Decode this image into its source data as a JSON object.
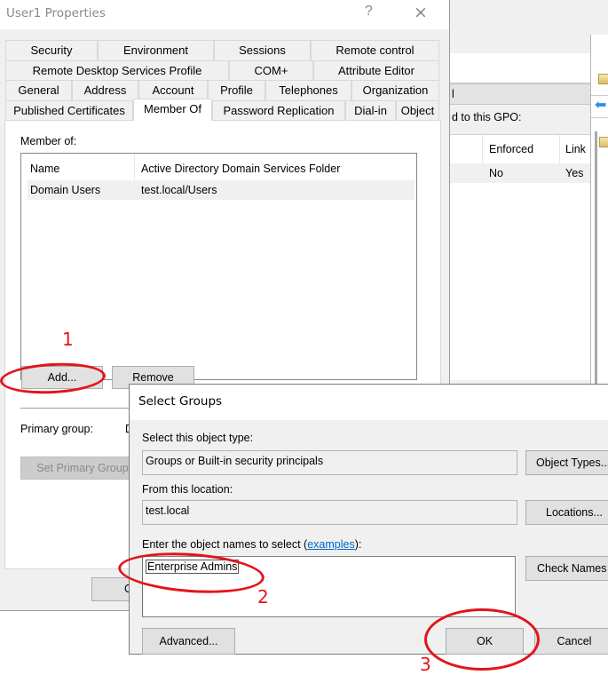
{
  "background_window": {
    "header_fragment": "l",
    "linked_label_fragment": "d to this GPO:",
    "columns": [
      "Enforced",
      "Link"
    ],
    "row": {
      "enforced": "No",
      "link": "Yes"
    }
  },
  "properties_dialog": {
    "title": "User1 Properties",
    "help_icon": "?",
    "close_icon": "×",
    "tab_rows": [
      [
        "Security",
        "Environment",
        "Sessions",
        "Remote control"
      ],
      [
        "Remote Desktop Services Profile",
        "COM+",
        "Attribute Editor"
      ],
      [
        "General",
        "Address",
        "Account",
        "Profile",
        "Telephones",
        "Organization"
      ],
      [
        "Published Certificates",
        "Member Of",
        "Password Replication",
        "Dial-in",
        "Object"
      ]
    ],
    "active_tab": "Member Of",
    "member_of_label": "Member of:",
    "member_list": {
      "columns": [
        "Name",
        "Active Directory Domain Services Folder"
      ],
      "rows": [
        {
          "name": "Domain Users",
          "folder": "test.local/Users"
        }
      ]
    },
    "add_button": "Add...",
    "remove_button": "Remove",
    "primary_group_label": "Primary group:",
    "primary_group_value": "D",
    "set_primary_group_button": "Set Primary Group",
    "ok_button_fragment": "O"
  },
  "select_groups_dialog": {
    "title": "Select Groups",
    "object_type_label": "Select this object type:",
    "object_type_value": "Groups or Built-in security principals",
    "object_types_button": "Object Types...",
    "location_label": "From this location:",
    "location_value": "test.local",
    "locations_button": "Locations...",
    "names_label_prefix": "Enter the object names to select (",
    "names_label_link": "examples",
    "names_label_suffix": "):",
    "names_value": "Enterprise Admins",
    "check_names_button": "Check Names",
    "advanced_button": "Advanced...",
    "ok_button": "OK",
    "cancel_button": "Cancel"
  },
  "annotations": {
    "step1": "1",
    "step2": "2",
    "step3": "3",
    "color": "#e3141b"
  }
}
